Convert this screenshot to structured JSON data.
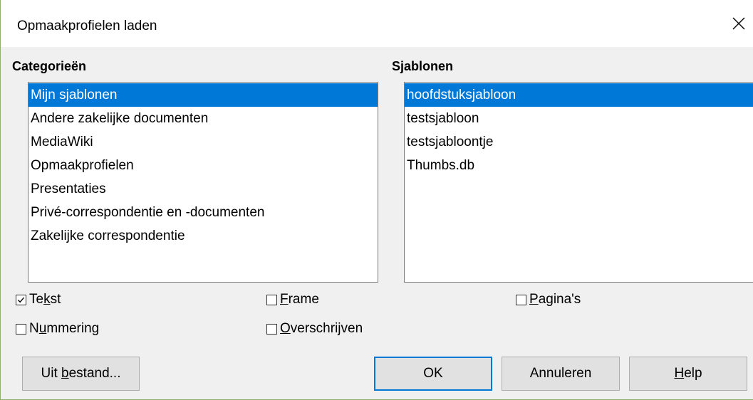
{
  "window": {
    "title": "Opmaakprofielen laden"
  },
  "categories": {
    "label": "Categorieën",
    "items": [
      "Mijn sjablonen",
      "Andere zakelijke documenten",
      "MediaWiki",
      "Opmaakprofielen",
      "Presentaties",
      "Privé-correspondentie en -documenten",
      "Zakelijke correspondentie"
    ],
    "selected_index": 0
  },
  "templates": {
    "label": "Sjablonen",
    "items": [
      "hoofdstuksjabloon",
      "testsjabloon",
      "testsjabloontje",
      "Thumbs.db"
    ],
    "selected_index": 0
  },
  "options": {
    "text": {
      "pre": "Te",
      "key": "k",
      "post": "st",
      "checked": true
    },
    "frame": {
      "pre": "",
      "key": "F",
      "post": "rame",
      "checked": false
    },
    "pages": {
      "pre": "",
      "key": "P",
      "post": "agina's",
      "checked": false
    },
    "numbering": {
      "pre": "N",
      "key": "u",
      "post": "mmering",
      "checked": false
    },
    "overwrite": {
      "pre": "",
      "key": "O",
      "post": "verschrijven",
      "checked": false
    }
  },
  "buttons": {
    "from_file": {
      "pre": "Uit ",
      "key": "b",
      "post": "estand..."
    },
    "ok": "OK",
    "cancel": "Annuleren",
    "help": {
      "pre": "",
      "key": "H",
      "post": "elp"
    }
  },
  "colors": {
    "selection": "#0078d7",
    "dialog_bg": "#f0f0f0",
    "button_bg": "#e1e1e1"
  }
}
